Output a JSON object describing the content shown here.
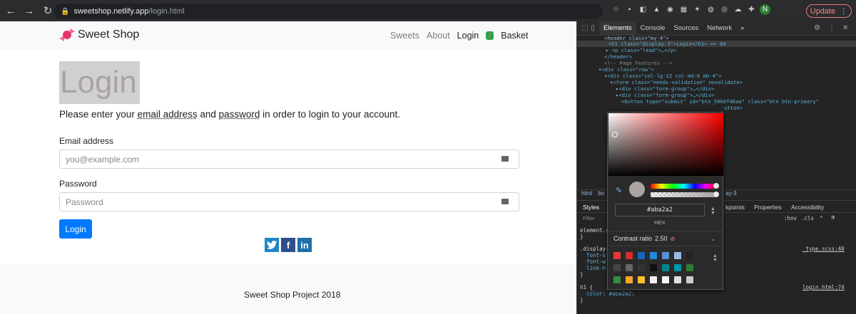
{
  "browser": {
    "url_host": "sweetshop.netlify.app",
    "url_path": "/login.html",
    "update_label": "Update",
    "profile_initial": "N"
  },
  "navbar": {
    "brand": "Sweet Shop",
    "links": [
      "Sweets",
      "About",
      "Login"
    ],
    "active_link": "Login",
    "basket_count": "1",
    "basket_label": "Basket"
  },
  "login": {
    "title": "Login",
    "lead_parts": [
      "Please enter your ",
      "email address",
      " and ",
      "password",
      " in order to login to your account."
    ],
    "email_label": "Email address",
    "email_placeholder": "you@example.com",
    "password_label": "Password",
    "password_placeholder": "Password",
    "submit_label": "Login"
  },
  "social": [
    "twitter-icon",
    "facebook-icon",
    "linkedin-icon"
  ],
  "footer": {
    "text": "Sweet Shop Project 2018"
  },
  "devtools": {
    "tabs": [
      "Elements",
      "Console",
      "Sources",
      "Network",
      "»"
    ],
    "active_tab": "Elements",
    "code_lines": [
      "<header class=\"my-4\">",
      "<h1 class=\"display-3\">Login</h1> == $0",
      "<p class=\"lead\">…</p>",
      "</header>",
      "<!-- Page Features -->",
      "<div class=\"row\">",
      "<div class=\"col-lg-12 col-md-6 mb-4\">",
      "<form class=\"needs-validation\" novalidate>",
      "<div class=\"form-group\">…</div>",
      "<div class=\"form-group\">…</div>",
      "<button type=\"submit\" id=\"btn_59k0f46aa\" class=\"btn btn-primary\"",
      "utton>"
    ],
    "breadcrumb_left": "html",
    "breadcrumb_mid": "bo",
    "breadcrumb_right": "ay-3",
    "style_tabs": [
      "Styles",
      "kpoints",
      "Properties",
      "Accessibility"
    ],
    "filter_placeholder": "Filter",
    "hov_label": ":hov",
    "cls_label": ".cls",
    "style_lines": [
      "element.s",
      "}",
      ".display-",
      "  font-s",
      "  font-w",
      "  line-h",
      "}",
      "h1 {",
      "  color: #aba2a2;",
      "}"
    ],
    "file_links": [
      "_type.scss:40",
      "login.html:74"
    ]
  },
  "color_picker": {
    "hex_value": "#aba2a2",
    "format_label": "HEX",
    "contrast_label": "Contrast ratio",
    "contrast_value": "2.50",
    "current_color": "#aba2a2",
    "palette": [
      "#e53935",
      "#d32f2f",
      "#1565c0",
      "#1e88e5",
      "#5c8dd6",
      "#9ab8e8",
      "#222222",
      "#444444",
      "#666666",
      "#333333",
      "#111111",
      "#00838f",
      "#0097a7",
      "#2e7d32",
      "#388e3c",
      "#f9a825",
      "#fbc02d",
      "#eeeeee",
      "#f5f5f5",
      "#e0e0e0",
      "#cccccc"
    ]
  }
}
